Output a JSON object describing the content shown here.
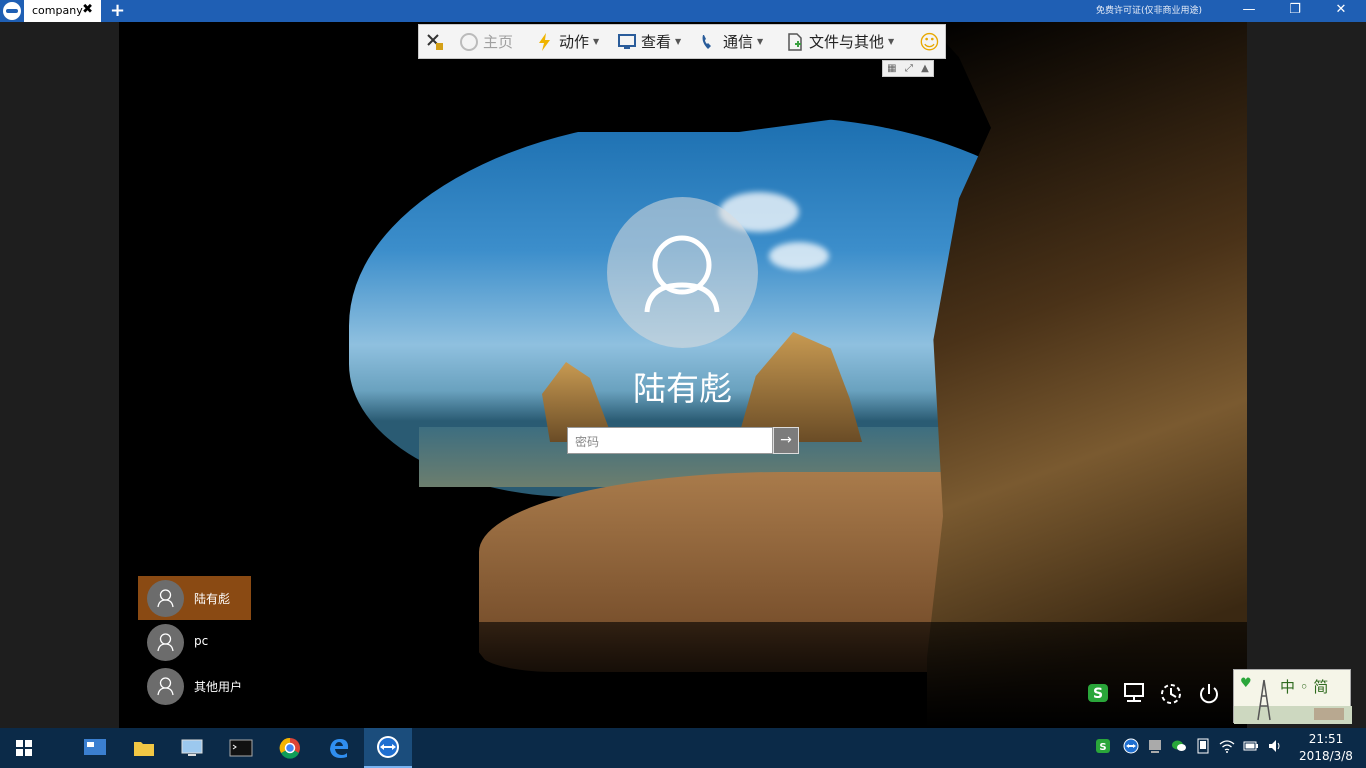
{
  "titlebar": {
    "tab_label": "company",
    "tab_close": "✖",
    "add_tab": "+",
    "license_text": "免费许可证(仅非商业用途)",
    "minimize": "—",
    "restore": "❐",
    "close": "✕"
  },
  "toolbar": {
    "home": "主页",
    "actions": "动作",
    "view": "查看",
    "communicate": "通信",
    "files_extras": "文件与其他",
    "smiley": "☺"
  },
  "login": {
    "username": "陆有彪",
    "password_placeholder": "密码",
    "submit_arrow": "→"
  },
  "users": [
    {
      "label": "陆有彪",
      "selected": true
    },
    {
      "label": "pc",
      "selected": false
    },
    {
      "label": "其他用户",
      "selected": false
    }
  ],
  "ime_widget": {
    "heart": "♥",
    "chars": "中 ◦ 简"
  },
  "clock": {
    "time": "21:51",
    "date": "2018/3/8"
  }
}
